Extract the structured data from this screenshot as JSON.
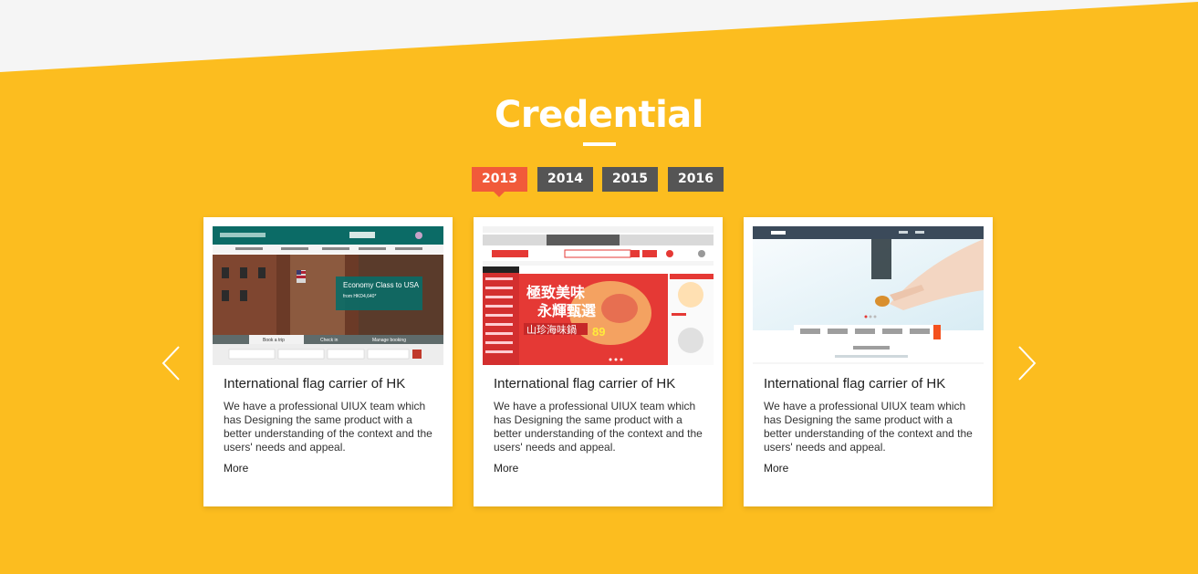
{
  "section": {
    "title": "Credential"
  },
  "years": [
    "2013",
    "2014",
    "2015",
    "2016"
  ],
  "active_year": "2013",
  "cards": [
    {
      "title": "International flag carrier of HK",
      "description": "We have a professional UIUX team which has Designing the same product with a better understanding of the context and the users' needs and appeal.",
      "more": "More",
      "thumb": {
        "tabs": [
          "Book a trip",
          "Check in",
          "Manage booking"
        ],
        "promo": "Economy Class to USA",
        "promo_sub": "from HKD4,640*"
      }
    },
    {
      "title": "International flag carrier of HK",
      "description": "We have a professional UIUX team which has Designing the same product with a better understanding of the context and the users' needs and appeal.",
      "more": "More",
      "thumb": {
        "banner_text": "極致美味",
        "banner_text2": "永輝甄選",
        "banner_sub": "山珍海味鍋",
        "price": "89"
      }
    },
    {
      "title": "International flag carrier of HK",
      "description": "We have a professional UIUX team which has Designing the same product with a better understanding of the context and the users' needs and appeal.",
      "more": "More",
      "thumb": {}
    }
  ],
  "colors": {
    "background": "#fcbd1f",
    "active_tab": "#f15a3a",
    "inactive_tab": "#555555"
  }
}
